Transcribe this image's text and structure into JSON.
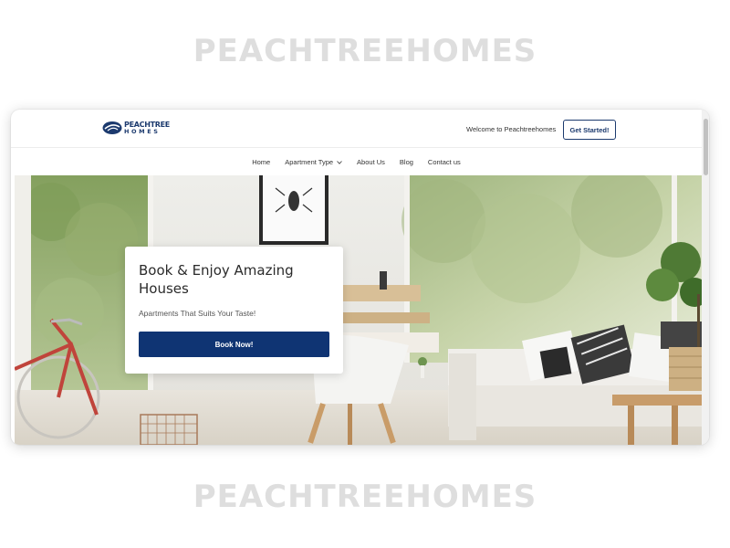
{
  "watermark": {
    "text": "PEACHTREEHOMES"
  },
  "brand": {
    "line1": "PEACHTREE",
    "line2": "HOMES",
    "color": "#1c3a6e"
  },
  "header": {
    "welcome_text": "Welcome to Peachtreehomes",
    "cta_label": "Get Started!"
  },
  "nav": {
    "items": [
      {
        "label": "Home"
      },
      {
        "label": "Apartment Type",
        "icon": "chevron-down-icon"
      },
      {
        "label": "About Us"
      },
      {
        "label": "Blog"
      },
      {
        "label": "Contact us"
      }
    ]
  },
  "hero": {
    "title": "Book & Enjoy Amazing Houses",
    "subtitle": "Apartments That Suits Your Taste!",
    "button_label": "Book Now!",
    "button_color": "#0f3473"
  }
}
